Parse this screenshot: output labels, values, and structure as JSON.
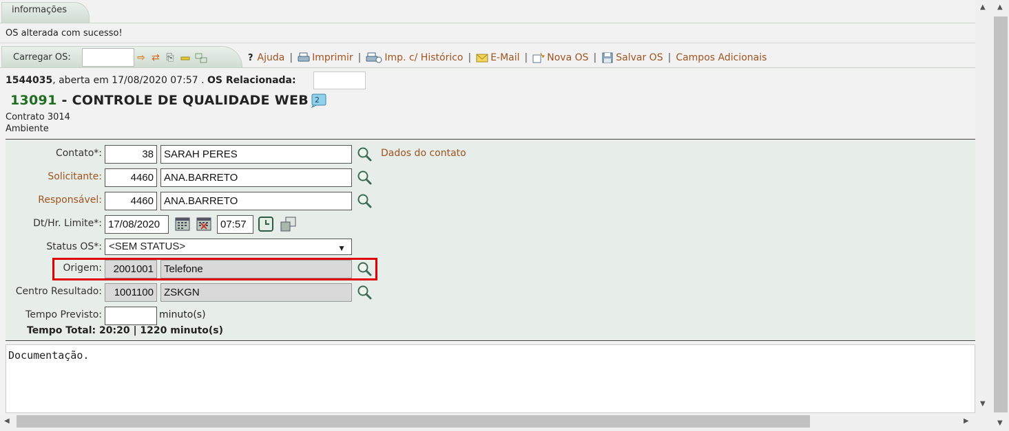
{
  "info": {
    "tab_label": "informações",
    "message": "OS alterada com sucesso!"
  },
  "toolbar": {
    "load_label": "Carregar OS:",
    "load_value": "",
    "help": "Ajuda",
    "print": "Imprimir",
    "print_history": "Imp. c/ Histórico",
    "email": "E-Mail",
    "new_os": "Nova OS",
    "save_os": "Salvar OS",
    "extra_fields": "Campos Adicionais",
    "separator": "|",
    "help_mark": "?"
  },
  "header": {
    "os_number": "1544035",
    "opened_text": ", aberta em 17/08/2020 07:57 . ",
    "related_label": "OS Relacionada:",
    "related_value": "",
    "client_code": "13091",
    "client_name": " - CONTROLE DE QUALIDADE WEB",
    "badge_count": "2",
    "contract": "Contrato 3014",
    "environment": "Ambiente"
  },
  "form": {
    "contato": {
      "label": "Contato*:",
      "code": "38",
      "name": "SARAH PERES",
      "link": "Dados do contato"
    },
    "solicitante": {
      "label": "Solicitante:",
      "code": "4460",
      "name": "ANA.BARRETO"
    },
    "responsavel": {
      "label": "Responsável:",
      "code": "4460",
      "name": "ANA.BARRETO"
    },
    "limite": {
      "label": "Dt/Hr. Limite*:",
      "date": "17/08/2020",
      "time": "07:57"
    },
    "status": {
      "label": "Status OS*:",
      "value": "<SEM STATUS>"
    },
    "origem": {
      "label": "Origem:",
      "code": "2001001",
      "name": "Telefone"
    },
    "centro": {
      "label": "Centro Resultado:",
      "code": "1001100",
      "name": "ZSKGN"
    },
    "tempo": {
      "label": "Tempo Previsto:",
      "value": "",
      "unit": "minuto(s)"
    },
    "total": "Tempo Total: 20:20 | 1220 minuto(s)"
  },
  "description": "Documentação.",
  "colors": {
    "link": "#a0531f",
    "client_code": "#1f6e1f",
    "highlight": "#e00000",
    "form_bg": "#e7ede8"
  }
}
